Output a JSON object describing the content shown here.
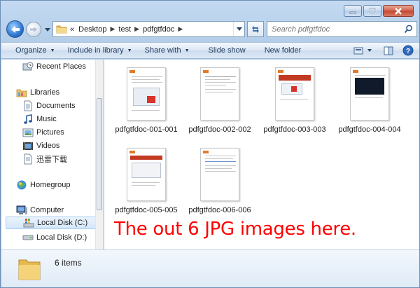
{
  "address": {
    "overflow": "«",
    "breadcrumbs": [
      "Desktop",
      "test",
      "pdfgtfdoc"
    ]
  },
  "search": {
    "placeholder": "Search pdfgtfdoc"
  },
  "toolbar": {
    "organize": "Organize",
    "include": "Include in library",
    "share": "Share with",
    "slideshow": "Slide show",
    "newfolder": "New folder"
  },
  "nav": {
    "recent": "Recent Places",
    "libraries": "Libraries",
    "documents": "Documents",
    "music": "Music",
    "pictures": "Pictures",
    "videos": "Videos",
    "thunder": "迅雷下载",
    "homegroup": "Homegroup",
    "computer": "Computer",
    "diskc": "Local Disk (C:)",
    "diskd": "Local Disk (D:)"
  },
  "files": [
    "pdfgtfdoc-001-001",
    "pdfgtfdoc-002-002",
    "pdfgtfdoc-003-003",
    "pdfgtfdoc-004-004",
    "pdfgtfdoc-005-005",
    "pdfgtfdoc-006-006"
  ],
  "annotation": "The out 6 JPG images here.",
  "status": {
    "count": "6 items"
  },
  "colors": {
    "annotation": "#ff0000",
    "accent": "#2e78d2"
  },
  "icons": {
    "caption": [
      "minimize-icon",
      "maximize-icon",
      "close-icon"
    ],
    "nav": [
      "back-arrow-icon",
      "forward-arrow-icon",
      "chevron-down-icon",
      "folder-icon",
      "refresh-icon",
      "search-icon"
    ],
    "toolbar": [
      "view-icon",
      "preview-pane-icon",
      "help-icon"
    ]
  }
}
